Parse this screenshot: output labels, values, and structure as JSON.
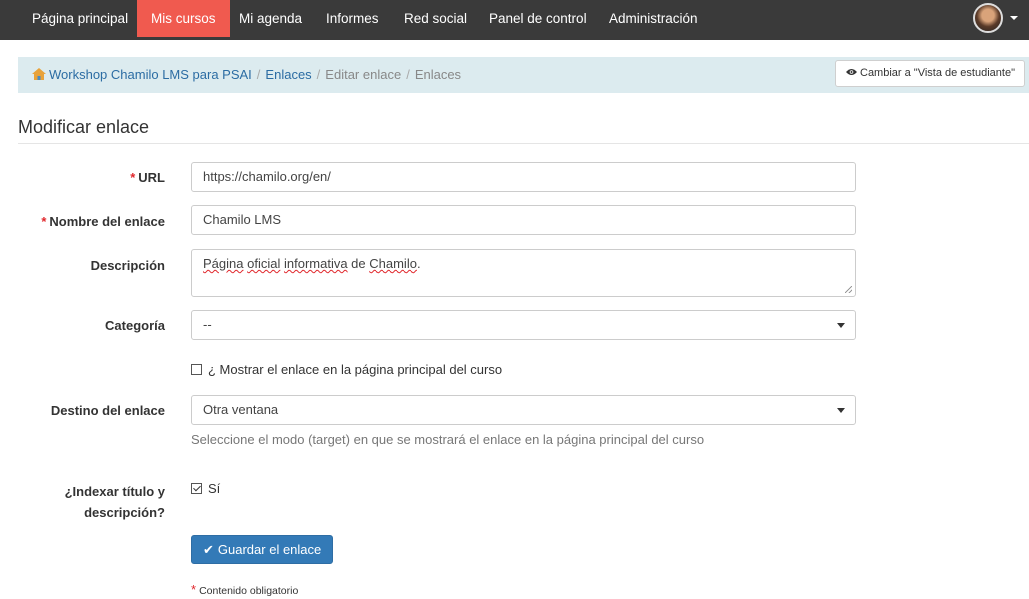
{
  "nav": {
    "items": [
      {
        "label": "Página principal",
        "active": false
      },
      {
        "label": "Mis cursos",
        "active": true
      },
      {
        "label": "Mi agenda",
        "active": false
      },
      {
        "label": "Informes",
        "active": false
      },
      {
        "label": "Red social",
        "active": false
      },
      {
        "label": "Panel de control",
        "active": false
      },
      {
        "label": "Administración",
        "active": false
      }
    ],
    "active_color": "#f05a4f",
    "background_color": "#3a3a3a"
  },
  "breadcrumb": {
    "items": [
      "Workshop Chamilo LMS para PSAI",
      "Enlaces",
      "Editar enlace",
      "Enlaces"
    ],
    "separator": "/",
    "home_icon": "home-icon"
  },
  "student_view_button": {
    "label": "Cambiar a \"Vista de estudiante\"",
    "icon": "eye-icon"
  },
  "page_title": "Modificar enlace",
  "form": {
    "required_marker": "*",
    "url": {
      "label": "URL",
      "value": "https://chamilo.org/en/"
    },
    "link_name": {
      "label": "Nombre del enlace",
      "value": "Chamilo LMS"
    },
    "description": {
      "label": "Descripción",
      "value_parts": [
        "Página",
        " ",
        "oficial",
        " ",
        "informativa",
        " de ",
        "Chamilo",
        "."
      ]
    },
    "category": {
      "label": "Categoría",
      "value": "--"
    },
    "show_on_homepage": {
      "label": "¿ Mostrar el enlace en la página principal del curso",
      "checked": false
    },
    "target": {
      "label": "Destino del enlace",
      "value": "Otra ventana",
      "help": "Seleccione el modo (target) en que se mostrará el enlace en la página principal del curso"
    },
    "index": {
      "label_line1": "¿Indexar título y",
      "label_line2": "descripción?",
      "option_label": "Sí",
      "checked": true
    },
    "save_button": {
      "label": "Guardar el enlace",
      "icon": "check-icon",
      "color": "#337ab7"
    },
    "required_note": "Contenido obligatorio"
  }
}
